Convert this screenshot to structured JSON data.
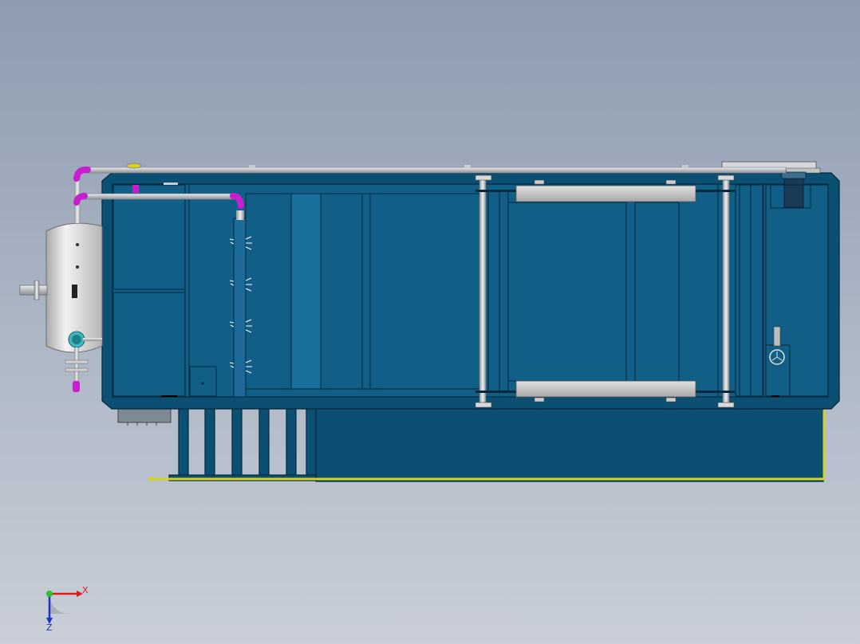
{
  "axes": {
    "x_label": "X",
    "z_label": "Z"
  },
  "colors": {
    "background_top": "#8d9cb0",
    "background_bottom": "#c9ced8",
    "tank_fill": "#0b4f72",
    "tank_edge": "#02283d",
    "panel_fill": "#115e87",
    "panel_light": "#1a6f9c",
    "pipe_grey": "#c9cdd2",
    "pipe_magenta": "#c81ecf",
    "pipe_yellow": "#d6d12a",
    "vessel_fill": "#d8d8d8",
    "skimmer_blade": "#c3c3c3",
    "axis_x": "#d42020",
    "axis_y": "#2fbf2f",
    "axis_z": "#2030c8"
  },
  "icons": {
    "motor": "motor-icon",
    "gauge": "pressure-gauge-icon",
    "triad": "coordinate-triad-icon"
  }
}
